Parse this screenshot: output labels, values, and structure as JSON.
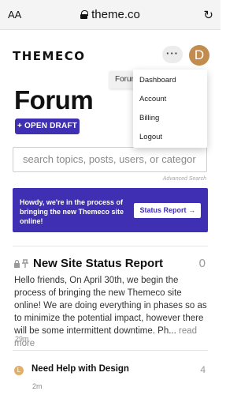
{
  "browser": {
    "text_size_label": "AA",
    "url": "theme.co"
  },
  "header": {
    "logo_text": "THEMECO",
    "more_label": "···",
    "avatar_initial": "D"
  },
  "breadcrumb_label": "Forum",
  "page": {
    "title": "Forum",
    "open_draft_label": "+ OPEN DRAFT"
  },
  "search": {
    "placeholder": "search topics, posts, users, or categor",
    "advanced_label": "Advanced Search"
  },
  "banner": {
    "message": "Howdy, we're in the process of bringing the new Themeco site online!",
    "button_label": "Status Report →"
  },
  "topics": [
    {
      "title": "New Site Status Report",
      "reply_count": "0",
      "excerpt": "Hello friends, On April 30th, we begin the process of bringing the new Themeco site online! We are doing everything in phases so as to minimize the potential impact, however there will be some intermittent downtime. Ph...",
      "read_more": "read more",
      "age": "29m"
    },
    {
      "title": "Need Help with Design",
      "reply_count": "4",
      "avatar_initial": "L",
      "age": "2m"
    }
  ],
  "user_menu": {
    "items": [
      "Dashboard",
      "Account",
      "Billing",
      "Logout"
    ]
  },
  "colors": {
    "brand": "#3e2fb3",
    "avatar_main": "#c18c4d",
    "avatar_small": "#e0b068"
  },
  "icons": [
    "lock-icon",
    "refresh-icon",
    "pin-icon"
  ]
}
